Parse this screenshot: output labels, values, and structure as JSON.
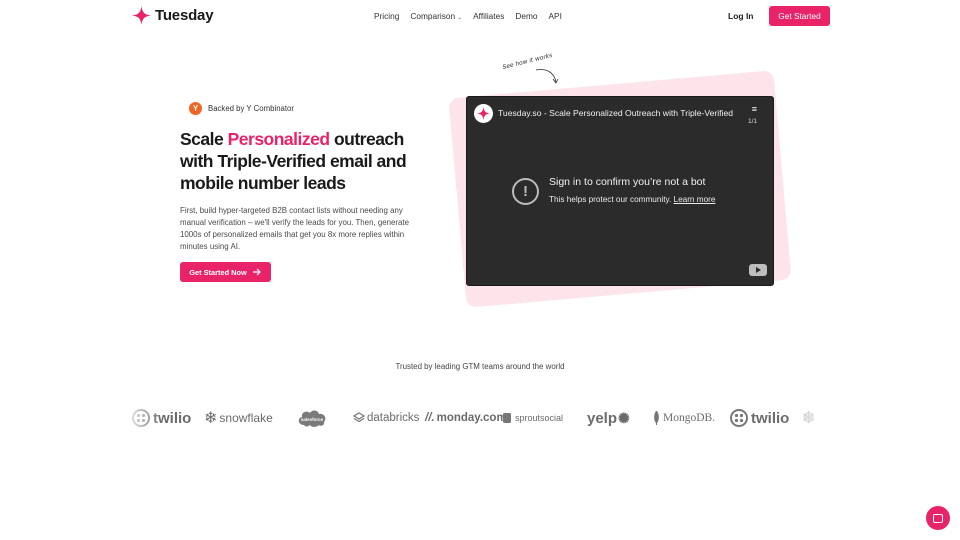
{
  "header": {
    "brand": "Tuesday",
    "nav": [
      "Pricing",
      "Comparison",
      "Affiliates",
      "Demo",
      "API"
    ],
    "login_label": "Log In",
    "cta_label": "Get Started"
  },
  "hero": {
    "badge": "Backed by Y Combinator",
    "badge_icon": "Y",
    "headline_pre": "Scale ",
    "headline_accent": "Personalized",
    "headline_post": " outreach with Triple-Verified email and mobile number leads",
    "body": "First, build hyper-targeted B2B contact lists without needing any manual verification – we'll verify the leads for you. Then, generate 1000s of personalized emails that get you 8x more replies within minutes using AI.",
    "cta_label": "Get Started Now"
  },
  "video": {
    "annotation": "See how it works",
    "title": "Tuesday.so - Scale Personalized Outreach with Triple-Verified",
    "playlist_count": "1/1",
    "message": "Sign in to confirm you’re not a bot",
    "sub_message": "This helps protect our community.",
    "learn_more": "Learn more"
  },
  "trusted": {
    "label": "Trusted by leading GTM teams around the world",
    "logos": [
      "twilio",
      "snowflake",
      "salesforce",
      "databricks",
      "monday.com",
      "sproutsocial",
      "yelp",
      "MongoDB.",
      "twilio",
      "snowflake"
    ]
  },
  "colors": {
    "accent": "#e8236a",
    "video_bg": "#2b2b2b",
    "card_bg": "#fde4ea"
  }
}
